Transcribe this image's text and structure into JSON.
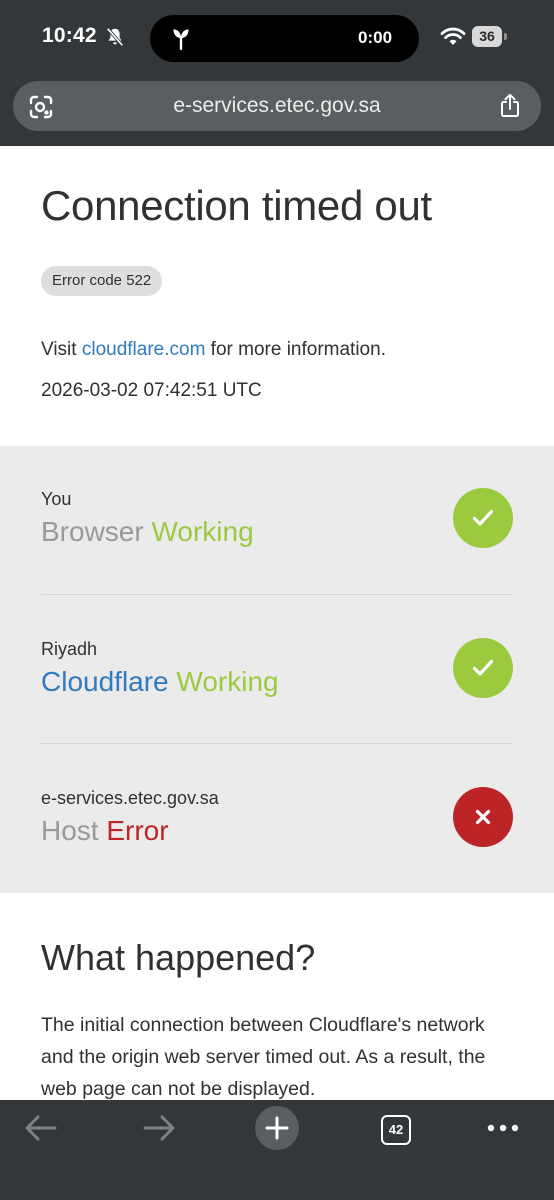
{
  "status_bar": {
    "time": "10:42",
    "island_timer": "0:00",
    "battery": "36",
    "icons": [
      "bell-slash-icon",
      "plant-icon",
      "wifi-icon",
      "battery-icon"
    ]
  },
  "browser": {
    "url": "e-services.etec.gov.sa",
    "icons": [
      "lens-icon",
      "share-icon"
    ]
  },
  "error_page": {
    "title": "Connection timed out",
    "error_code": "Error code 522",
    "visit_prefix": "Visit ",
    "visit_link": "cloudflare.com",
    "visit_suffix": " for more information.",
    "timestamp": "2026-03-02 07:42:51 UTC",
    "status_rows": [
      {
        "sub": "You",
        "name": "Browser",
        "state": "Working",
        "result": "ok"
      },
      {
        "sub": "Riyadh",
        "name": "Cloudflare",
        "state": "Working",
        "result": "ok"
      },
      {
        "sub": "e-services.etec.gov.sa",
        "name": "Host",
        "state": "Error",
        "result": "error"
      }
    ],
    "what_happened_title": "What happened?",
    "what_happened_body": "The initial connection between Cloudflare's network and the origin web server timed out. As a result, the web page can not be displayed."
  },
  "toolbar": {
    "tab_count": "42",
    "icons": [
      "back-arrow-icon",
      "forward-arrow-icon",
      "new-tab-plus-icon",
      "tabs-icon",
      "more-icon"
    ]
  },
  "colors": {
    "chrome": "#343739",
    "working": "#9bca3e",
    "error": "#bd2426",
    "link": "#2f7bbf"
  }
}
